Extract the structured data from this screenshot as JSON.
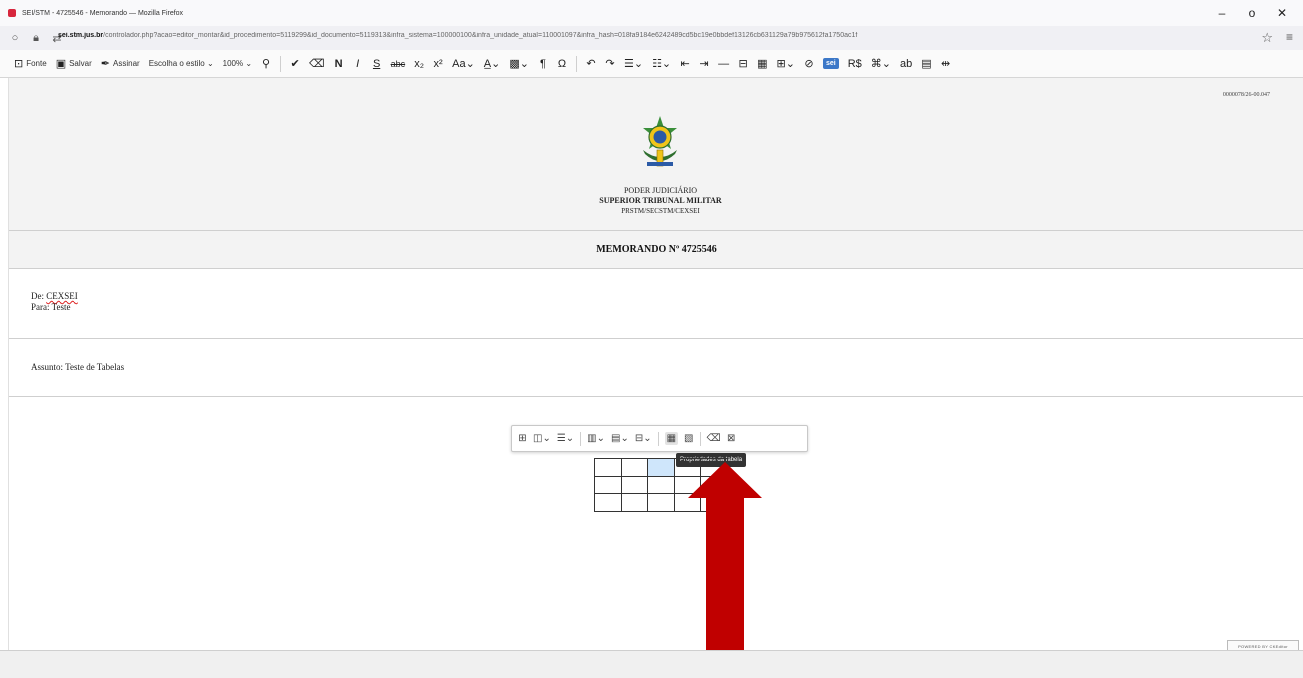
{
  "window": {
    "title": "SEI/STM - 4725546 - Memorando — Mozilla Firefox",
    "minimize": "–",
    "restore": "o",
    "close": "✕"
  },
  "urlbar": {
    "host": "sei.stm.jus.br",
    "path": "/controlador.php?acao=editor_montar&id_procedimento=5119299&id_documento=5119313&infra_sistema=100000100&infra_unidade_atual=110001097&infra_hash=018fa9184e6242489cd5bc19e0bbdef13126cb631129a79b975612fa1750ac1f"
  },
  "toolbar": {
    "fonte": "Fonte",
    "salvar": "Salvar",
    "assinar": "Assinar",
    "estilo": "Escolha o estilo ⌄",
    "zoom": "100% ⌄",
    "sei": "sei"
  },
  "document": {
    "doc_number": "0000078/26-00.047",
    "org_line1": "PODER JUDICIÁRIO",
    "org_line2": "SUPERIOR TRIBUNAL MILITAR",
    "org_line3": "PRSTM/SECSTM/CEXSEI",
    "memo_title": "MEMORANDO Nº 4725546",
    "from_label": "De: ",
    "from_value": "CEXSEI",
    "to_line": "Para: Teste",
    "subject_line": "Assunto: Teste de Tabelas"
  },
  "table_toolbar": {
    "tooltip": "Propriedades da tabela"
  },
  "table": {
    "rows": 3,
    "cols": 5,
    "selected_cell": [
      0,
      2
    ]
  },
  "powered": "POWERED BY CKEditor",
  "colors": {
    "arrow": "#c00000",
    "selected_cell": "#cfe6fb",
    "header_bg": "#f3f3f3"
  }
}
